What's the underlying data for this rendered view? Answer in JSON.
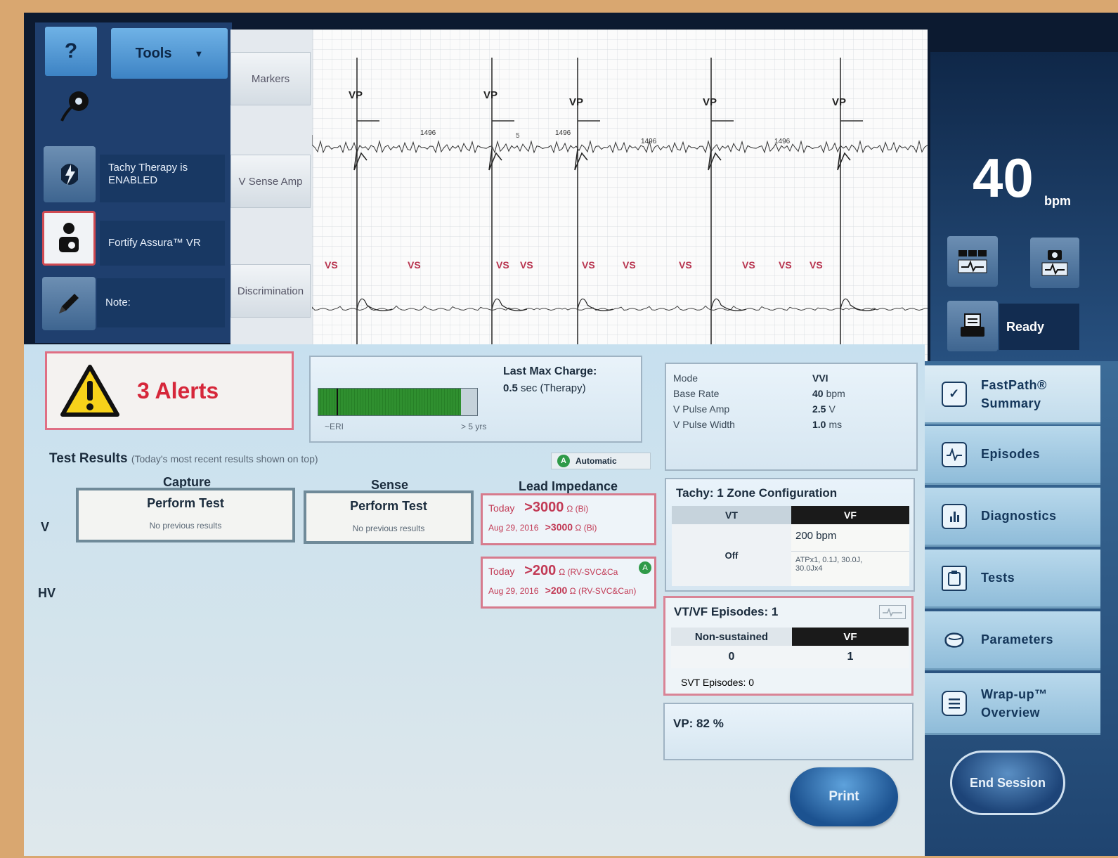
{
  "toolbar": {
    "help_label": "?",
    "tools_label": "Tools"
  },
  "status": {
    "tachy_therapy": "Tachy Therapy is\nENABLED",
    "device_name": "Fortify Assura™ VR",
    "note_label": "Note:"
  },
  "ecg": {
    "tabs": [
      "Markers",
      "V Sense Amp",
      "Discrimination"
    ],
    "pace_markers": [
      "VP",
      "VP",
      "VP",
      "VP",
      "VP"
    ],
    "interval_labels": [
      "1496",
      "1496",
      "1496",
      "1496"
    ],
    "sense_markers": [
      "VS",
      "VS",
      "VS",
      "VS",
      "VS",
      "VS",
      "VS",
      "VS",
      "VS",
      "VS"
    ]
  },
  "rate": {
    "value": "40",
    "unit": "bpm"
  },
  "printer": {
    "status": "Ready"
  },
  "alerts": {
    "label": "3 Alerts"
  },
  "battery": {
    "last_max_charge_title": "Last Max Charge:",
    "last_max_charge_value": "0.5",
    "last_max_charge_unit": "sec (Therapy)",
    "left_label": "~ERI",
    "right_label": "> 5 yrs",
    "fill_fraction": 0.9
  },
  "parameters_summary": {
    "rows": [
      {
        "label": "Mode",
        "value": "VVI",
        "unit": ""
      },
      {
        "label": "Base Rate",
        "value": "40",
        "unit": "bpm"
      },
      {
        "label": "V Pulse Amp",
        "value": "2.5",
        "unit": "V"
      },
      {
        "label": "V Pulse Width",
        "value": "1.0",
        "unit": "ms"
      }
    ]
  },
  "tests": {
    "title": "Test Results",
    "subtitle": "(Today's most recent results shown on top)",
    "automatic_label": "Automatic",
    "col_capture": "Capture",
    "col_sense": "Sense",
    "col_lead": "Lead Impedance",
    "row_v": "V",
    "row_hv": "HV",
    "perform_test": "Perform Test",
    "no_previous": "No previous results",
    "v_lead": {
      "today_label": "Today",
      "today_value": ">3000",
      "today_unit": "Ω (Bi)",
      "prev_date": "Aug 29, 2016",
      "prev_value": ">3000",
      "prev_unit": "Ω (Bi)"
    },
    "hv_lead": {
      "today_label": "Today",
      "today_value": ">200",
      "today_unit": "Ω (RV-SVC&Ca",
      "prev_date": "Aug 29, 2016",
      "prev_value": ">200",
      "prev_unit": "Ω (RV-SVC&Can)"
    }
  },
  "tachy_config": {
    "title": "Tachy: 1 Zone Configuration",
    "col_vt": "VT",
    "col_vf": "VF",
    "vt_value": "Off",
    "vf_rate": "200 bpm",
    "vf_therapy": "ATPx1, 0.1J, 30.0J,\n30.0Jx4"
  },
  "episodes_card": {
    "title": "VT/VF Episodes: 1",
    "col_nonsustained": "Non-sustained",
    "col_vf": "VF",
    "nonsustained_value": "0",
    "vf_value": "1",
    "svt_label": "SVT Episodes: 0"
  },
  "vp": {
    "label": "VP: 82 %"
  },
  "nav": {
    "fastpath": "FastPath®\nSummary",
    "episodes": "Episodes",
    "diagnostics": "Diagnostics",
    "tests": "Tests",
    "parameters": "Parameters",
    "wrapup": "Wrap-up™\nOverview"
  },
  "actions": {
    "print": "Print",
    "end_session": "End Session"
  },
  "colors": {
    "alert_red": "#d6273a",
    "marker_pink": "#b8344f",
    "battery_green": "#2f8f2f",
    "nav_blue": "#9fcbe5",
    "panel_navy": "#1f3f6e"
  }
}
